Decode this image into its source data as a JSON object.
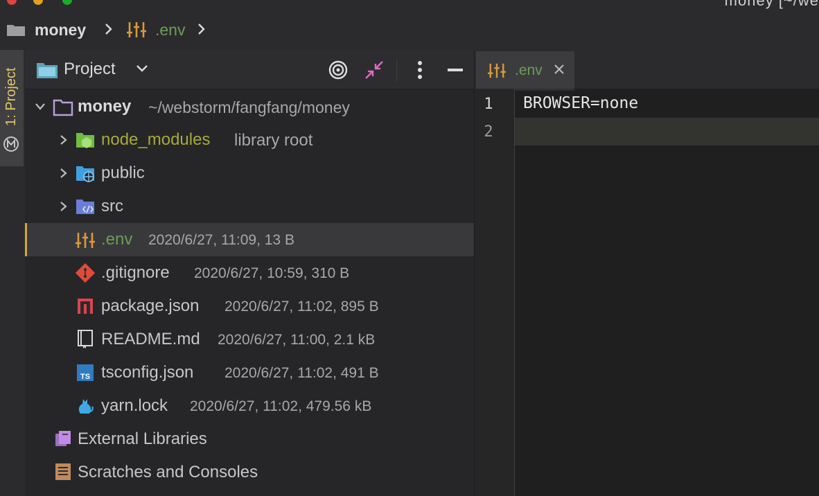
{
  "window": {
    "title": "money [~/we"
  },
  "breadcrumb": {
    "root": "money",
    "file": ".env"
  },
  "toolstrip": {
    "label": "1: Project"
  },
  "panel": {
    "title": "Project"
  },
  "tree": {
    "root": {
      "name": "money",
      "path": "~/webstorm/fangfang/money"
    },
    "items": [
      {
        "name": "node_modules",
        "meta": "library root",
        "color": "#a9a93a"
      },
      {
        "name": "public",
        "meta": "",
        "color": "#c7c7c7"
      },
      {
        "name": "src",
        "meta": "",
        "color": "#c7c7c7"
      },
      {
        "name": ".env",
        "meta": "2020/6/27, 11:09, 13 B",
        "color": "#6a9f55"
      },
      {
        "name": ".gitignore",
        "meta": "2020/6/27, 10:59, 310 B",
        "color": "#c7c7c7"
      },
      {
        "name": "package.json",
        "meta": "2020/6/27, 11:02, 895 B",
        "color": "#c7c7c7"
      },
      {
        "name": "README.md",
        "meta": "2020/6/27, 11:00, 2.1 kB",
        "color": "#c7c7c7"
      },
      {
        "name": "tsconfig.json",
        "meta": "2020/6/27, 11:02, 491 B",
        "color": "#c7c7c7"
      },
      {
        "name": "yarn.lock",
        "meta": "2020/6/27, 11:02, 479.56 kB",
        "color": "#c7c7c7"
      }
    ],
    "external": "External Libraries",
    "scratches": "Scratches and Consoles"
  },
  "editor": {
    "tab_label": ".env",
    "lines": [
      {
        "number": "1",
        "text": "BROWSER=none"
      },
      {
        "number": "2",
        "text": ""
      }
    ]
  }
}
